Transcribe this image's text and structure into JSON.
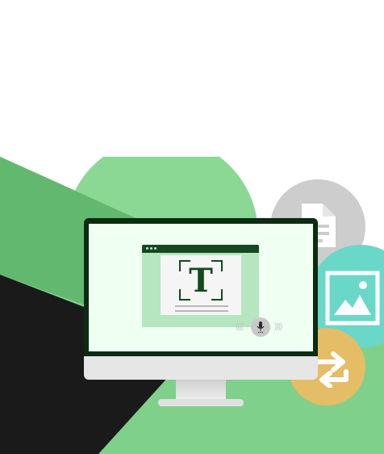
{
  "illustration": {
    "app_window": {
      "glyph": "T"
    },
    "icons": {
      "document": "document-icon",
      "image": "image-icon",
      "convert": "convert-arrows-icon",
      "microphone": "microphone-icon",
      "text_scan": "text-scan-icon"
    },
    "colors": {
      "bright_green": "#7fd08b",
      "mid_green": "#62b86f",
      "dark_panel": "#1a1a1a",
      "frame_dark_green": "#0d2b12",
      "screen_bg": "#effff1",
      "window_green": "#b5e6bf",
      "glyph_green": "#14491e",
      "doc_circle": "#cdcdcd",
      "image_circle": "#69d8c8",
      "convert_circle": "#e5bd67"
    }
  }
}
